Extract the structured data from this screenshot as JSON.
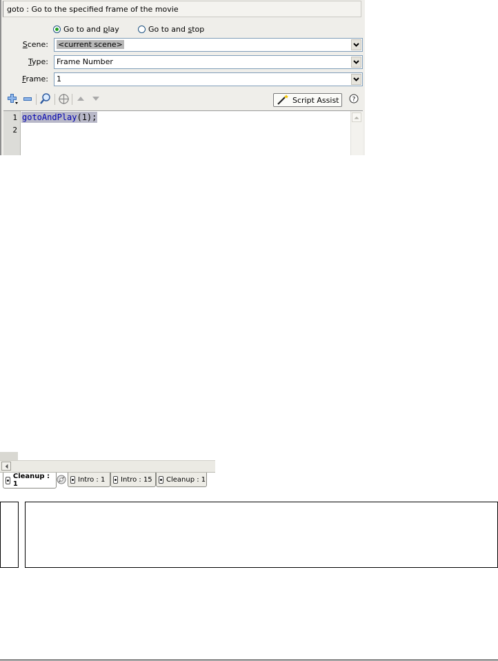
{
  "panel": {
    "description": "goto : Go to the specified frame of the movie",
    "radio_play": {
      "pre": "Go to and ",
      "accel": "p",
      "post": "lay",
      "checked": true
    },
    "radio_stop": {
      "pre": "Go to and ",
      "accel": "s",
      "post": "top",
      "checked": false
    },
    "scene": {
      "label_accel": "S",
      "label_rest": "cene:",
      "value": "<current scene>"
    },
    "type": {
      "label_accel": "T",
      "label_rest": "ype:",
      "value": "Frame Number"
    },
    "frame": {
      "label_accel": "F",
      "label_rest": "rame:",
      "value": "1"
    },
    "toolbar": {
      "script_assist_label": "Script Assist",
      "icons": [
        "add-statement-icon",
        "remove-statement-icon",
        "find-icon",
        "target-path-icon",
        "move-up-icon",
        "move-down-icon",
        "magic-wand-icon",
        "help-icon"
      ]
    },
    "editor": {
      "line_numbers": [
        "1",
        "2"
      ],
      "code_keyword": "gotoAndPlay",
      "code_rest": "(1);"
    }
  },
  "timeline": {
    "tabs": [
      {
        "label": "Cleanup : 1",
        "active": true
      },
      {
        "label": "Intro : 1",
        "active": false
      },
      {
        "label": "Intro : 15",
        "active": false
      },
      {
        "label": "Cleanup : 1",
        "active": false
      }
    ]
  },
  "colors": {
    "panel_bg": "#efeeea",
    "code_keyword": "#0000b0",
    "selection": "#b8b8c8"
  }
}
